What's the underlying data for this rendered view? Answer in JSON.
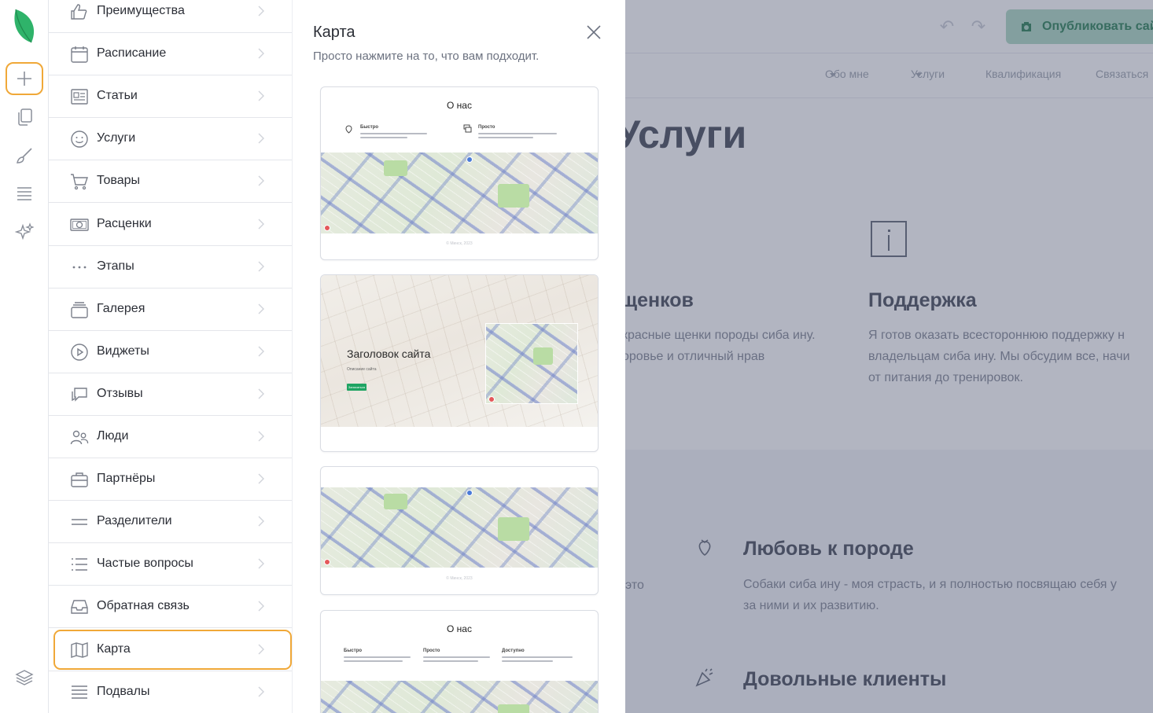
{
  "site": {
    "publish_label": "Опубликовать сайт",
    "nav": [
      "Обо мне",
      "Услуги",
      "Квалификация",
      "Связаться"
    ],
    "heading": "Услуги",
    "col1_title": "щенков",
    "col1_text": [
      "красные щенки породы сиба ину.",
      "оровье и отличный нрав"
    ],
    "col2_title": "Поддержка",
    "col2_text": [
      "Я готов оказать всестороннюю поддержку н",
      "владельцам сиба ину. Мы обсудим все, начи",
      "от питания до тренировок."
    ],
    "band_left_text": "это",
    "feature1_title": "Любовь к породе",
    "feature1_text": [
      "Собаки сиба ину - моя страсть, и я полностью посвящаю себя у",
      "за ними и их развитию."
    ],
    "feature2_title": "Довольные клиенты"
  },
  "rail": {
    "icons": [
      "logo-leaf-icon",
      "plus-icon",
      "pages-icon",
      "brush-icon",
      "sections-icon",
      "sparkle-icon",
      "layers-icon"
    ],
    "active": "plus-icon",
    "active_color": "#f0a838"
  },
  "categories": [
    {
      "label": "Преимущества",
      "icon": "thumbs-up-icon"
    },
    {
      "label": "Расписание",
      "icon": "calendar-icon"
    },
    {
      "label": "Статьи",
      "icon": "article-icon"
    },
    {
      "label": "Услуги",
      "icon": "smile-icon"
    },
    {
      "label": "Товары",
      "icon": "cart-icon"
    },
    {
      "label": "Расценки",
      "icon": "money-icon"
    },
    {
      "label": "Этапы",
      "icon": "dots-icon"
    },
    {
      "label": "Галерея",
      "icon": "gallery-icon"
    },
    {
      "label": "Виджеты",
      "icon": "play-icon"
    },
    {
      "label": "Отзывы",
      "icon": "chat-icon"
    },
    {
      "label": "Люди",
      "icon": "people-icon"
    },
    {
      "label": "Партнёры",
      "icon": "briefcase-icon"
    },
    {
      "label": "Разделители",
      "icon": "divider-icon"
    },
    {
      "label": "Частые вопросы",
      "icon": "list-icon"
    },
    {
      "label": "Обратная связь",
      "icon": "inbox-icon"
    },
    {
      "label": "Карта",
      "icon": "map-icon",
      "selected": true
    },
    {
      "label": "Подвалы",
      "icon": "footer-icon"
    }
  ],
  "panel": {
    "title": "Карта",
    "subtitle": "Просто нажмите на то, что вам подходит.",
    "cards": [
      {
        "title": "О нас",
        "cols": [
          "Быстро",
          "Просто"
        ],
        "footer": "© Минск, 2023"
      },
      {
        "hero_title": "Заголовок сайта",
        "hero_sub": "Описание сайта",
        "hero_btn": "Записаться"
      },
      {
        "footer": "© Минск, 2023"
      },
      {
        "title": "О нас",
        "cols": [
          "Быстро",
          "Просто",
          "Доступно"
        ]
      }
    ]
  }
}
